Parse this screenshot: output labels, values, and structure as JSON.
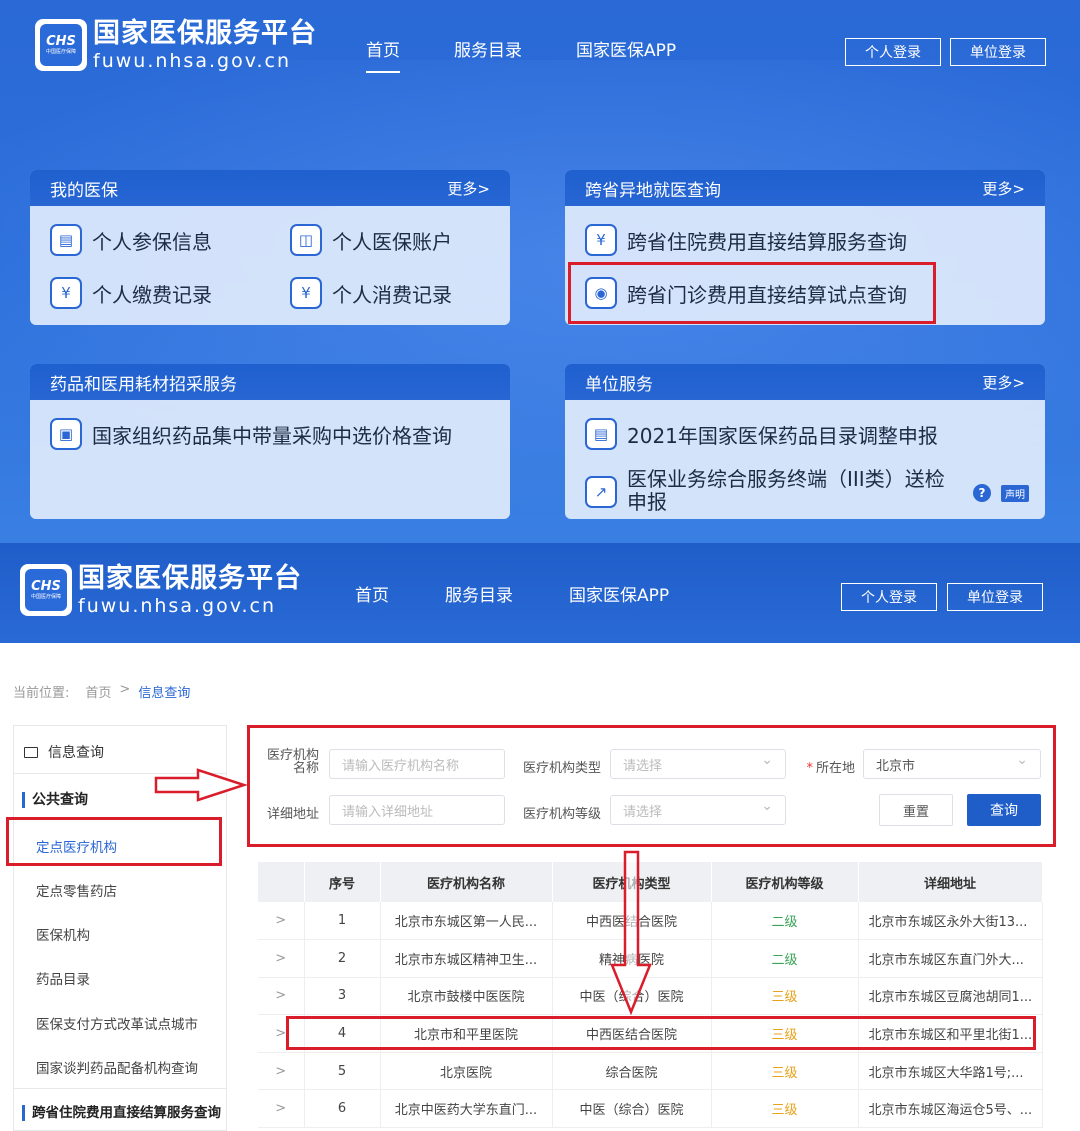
{
  "brand": {
    "title": "国家医保服务平台",
    "url": "fuwu.nhsa.gov.cn",
    "badge_text": "CHS",
    "badge_sub": "中国医疗保障"
  },
  "nav": {
    "items": [
      "首页",
      "服务目录",
      "国家医保APP"
    ],
    "login_personal": "个人登录",
    "login_unit": "单位登录"
  },
  "cards": {
    "my_insurance": {
      "title": "我的医保",
      "more": "更多>",
      "items": [
        "个人参保信息",
        "个人医保账户",
        "个人缴费记录",
        "个人消费记录"
      ]
    },
    "cross_province": {
      "title": "跨省异地就医查询",
      "more": "更多>",
      "items": [
        "跨省住院费用直接结算服务查询",
        "跨省门诊费用直接结算试点查询"
      ]
    },
    "drugs": {
      "title": "药品和医用耗材招采服务",
      "items": [
        "国家组织药品集中带量采购中选价格查询"
      ]
    },
    "unit_service": {
      "title": "单位服务",
      "more": "更多>",
      "items": [
        "2021年国家医保药品目录调整申报",
        "医保业务综合服务终端（III类）送检",
        "申报"
      ],
      "tag": "声明",
      "help": "?"
    }
  },
  "breadcrumb": {
    "label": "当前位置:",
    "home": "首页",
    "sep": ">",
    "current": "信息查询"
  },
  "sidebar": {
    "title": "信息查询",
    "group1": "公共查询",
    "items": [
      "定点医疗机构",
      "定点零售药店",
      "医保机构",
      "药品目录",
      "医保支付方式改革试点城市",
      "国家谈判药品配备机构查询"
    ],
    "group2": "跨省住院费用直接结算服务查询"
  },
  "form": {
    "name_label_1": "医疗机构",
    "name_label_2": "名称",
    "name_placeholder": "请输入医疗机构名称",
    "type_label": "医疗机构类型",
    "type_placeholder": "请选择",
    "location_label": "所在地",
    "location_value": "北京市",
    "address_label": "详细地址",
    "address_placeholder": "请输入详细地址",
    "level_label": "医疗机构等级",
    "level_placeholder": "请选择",
    "reset": "重置",
    "query": "查询"
  },
  "table": {
    "columns": [
      "",
      "序号",
      "医疗机构名称",
      "医疗机构类型",
      "医疗机构等级",
      "详细地址"
    ],
    "rows": [
      {
        "exp": ">",
        "no": "1",
        "name": "北京市东城区第一人民...",
        "type": "中西医结合医院",
        "level": "二级",
        "addr": "北京市东城区永外大街13..."
      },
      {
        "exp": ">",
        "no": "2",
        "name": "北京市东城区精神卫生...",
        "type": "精神病医院",
        "level": "二级",
        "addr": "北京市东城区东直门外大..."
      },
      {
        "exp": ">",
        "no": "3",
        "name": "北京市鼓楼中医医院",
        "type": "中医（综合）医院",
        "level": "三级",
        "addr": "北京市东城区豆腐池胡同1..."
      },
      {
        "exp": ">",
        "no": "4",
        "name": "北京市和平里医院",
        "type": "中西医结合医院",
        "level": "三级",
        "addr": "北京市东城区和平里北街1..."
      },
      {
        "exp": ">",
        "no": "5",
        "name": "北京医院",
        "type": "综合医院",
        "level": "三级",
        "addr": "北京市东城区大华路1号;..."
      },
      {
        "exp": ">",
        "no": "6",
        "name": "北京中医药大学东直门...",
        "type": "中医（综合）医院",
        "level": "三级",
        "addr": "北京市东城区海运仓5号、..."
      }
    ]
  },
  "colors": {
    "brand_blue": "#2a67d4",
    "highlight_red": "#d91d2a",
    "level_orange": "#e8a21a",
    "level_green": "#3aa357"
  }
}
